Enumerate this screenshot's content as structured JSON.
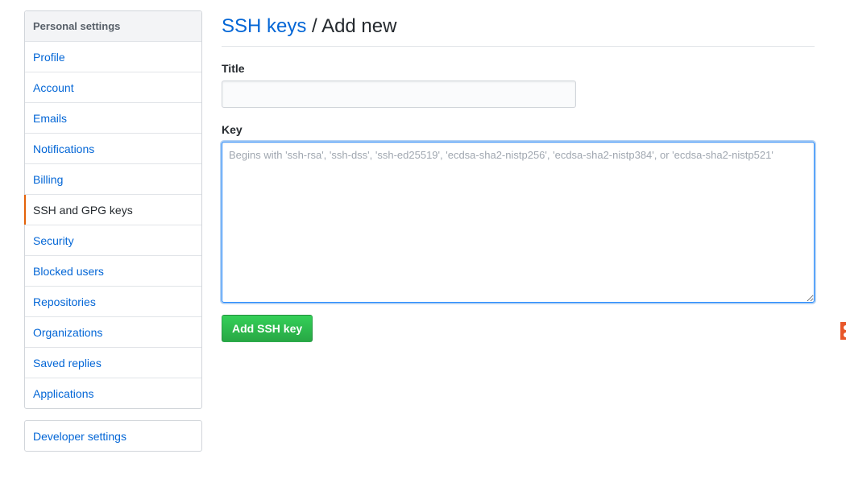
{
  "sidebar": {
    "heading": "Personal settings",
    "items": [
      {
        "label": "Profile",
        "selected": false
      },
      {
        "label": "Account",
        "selected": false
      },
      {
        "label": "Emails",
        "selected": false
      },
      {
        "label": "Notifications",
        "selected": false
      },
      {
        "label": "Billing",
        "selected": false
      },
      {
        "label": "SSH and GPG keys",
        "selected": true
      },
      {
        "label": "Security",
        "selected": false
      },
      {
        "label": "Blocked users",
        "selected": false
      },
      {
        "label": "Repositories",
        "selected": false
      },
      {
        "label": "Organizations",
        "selected": false
      },
      {
        "label": "Saved replies",
        "selected": false
      },
      {
        "label": "Applications",
        "selected": false
      }
    ],
    "developer_settings": "Developer settings"
  },
  "header": {
    "link": "SSH keys",
    "separator": " / ",
    "title": "Add new"
  },
  "form": {
    "title_label": "Title",
    "title_value": "",
    "key_label": "Key",
    "key_value": "",
    "key_placeholder": "Begins with 'ssh-rsa', 'ssh-dss', 'ssh-ed25519', 'ecdsa-sha2-nistp256', 'ecdsa-sha2-nistp384', or 'ecdsa-sha2-nistp521'",
    "submit_label": "Add SSH key"
  },
  "colors": {
    "link": "#0366d6",
    "selected_marker": "#e36209",
    "primary_button": "#28a745",
    "focus_border": "#2188ff"
  },
  "icons": {
    "edge_icon": "extension-icon"
  }
}
